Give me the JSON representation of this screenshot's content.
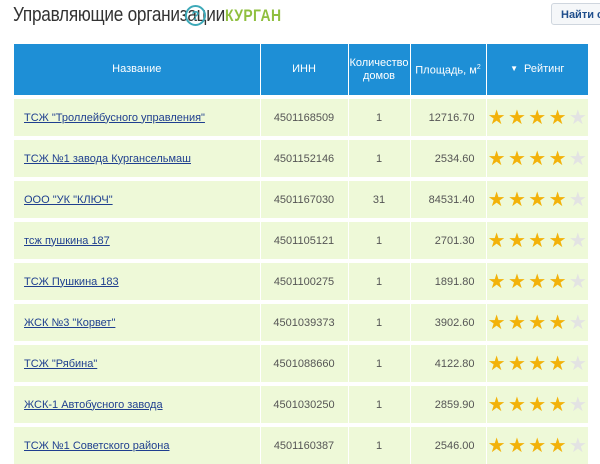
{
  "header": {
    "title": "Управляющие организации",
    "help_glyph": "?",
    "city": "КУРГАН",
    "find_button": "Найти св"
  },
  "table": {
    "columns": {
      "name": "Название",
      "inn": "ИНН",
      "houses": "Количество домов",
      "area": "Площадь, м",
      "area_sup": "2",
      "rating": "Рейтинг",
      "sort_arrow": "▼"
    },
    "rows": [
      {
        "name": "ТСЖ \"Троллейбусного управления\"",
        "inn": "4501168509",
        "houses": "1",
        "area": "12716.70",
        "rating": 4
      },
      {
        "name": "ТСЖ №1 завода Кургансельмаш",
        "inn": "4501152146",
        "houses": "1",
        "area": "2534.60",
        "rating": 4
      },
      {
        "name": "ООО \"УК \"КЛЮЧ\"",
        "inn": "4501167030",
        "houses": "31",
        "area": "84531.40",
        "rating": 4
      },
      {
        "name": "тсж пушкина 187",
        "inn": "4501105121",
        "houses": "1",
        "area": "2701.30",
        "rating": 4
      },
      {
        "name": "ТСЖ Пушкина 183",
        "inn": "4501100275",
        "houses": "1",
        "area": "1891.80",
        "rating": 4
      },
      {
        "name": "ЖСК №3 \"Корвет\"",
        "inn": "4501039373",
        "houses": "1",
        "area": "3902.60",
        "rating": 4
      },
      {
        "name": "ТСЖ \"Рябина\"",
        "inn": "4501088660",
        "houses": "1",
        "area": "4122.80",
        "rating": 4
      },
      {
        "name": "ЖСК-1 Автобусного завода",
        "inn": "4501030250",
        "houses": "1",
        "area": "2859.90",
        "rating": 4
      },
      {
        "name": "ТСЖ №1 Советского района",
        "inn": "4501160387",
        "houses": "1",
        "area": "2546.00",
        "rating": 4
      }
    ],
    "rating_max": 5,
    "star_color_on": "#f2b20a",
    "star_color_off": "#e3e3e3",
    "header_color": "#1e8fd6",
    "row_color": "#eef9d8"
  }
}
